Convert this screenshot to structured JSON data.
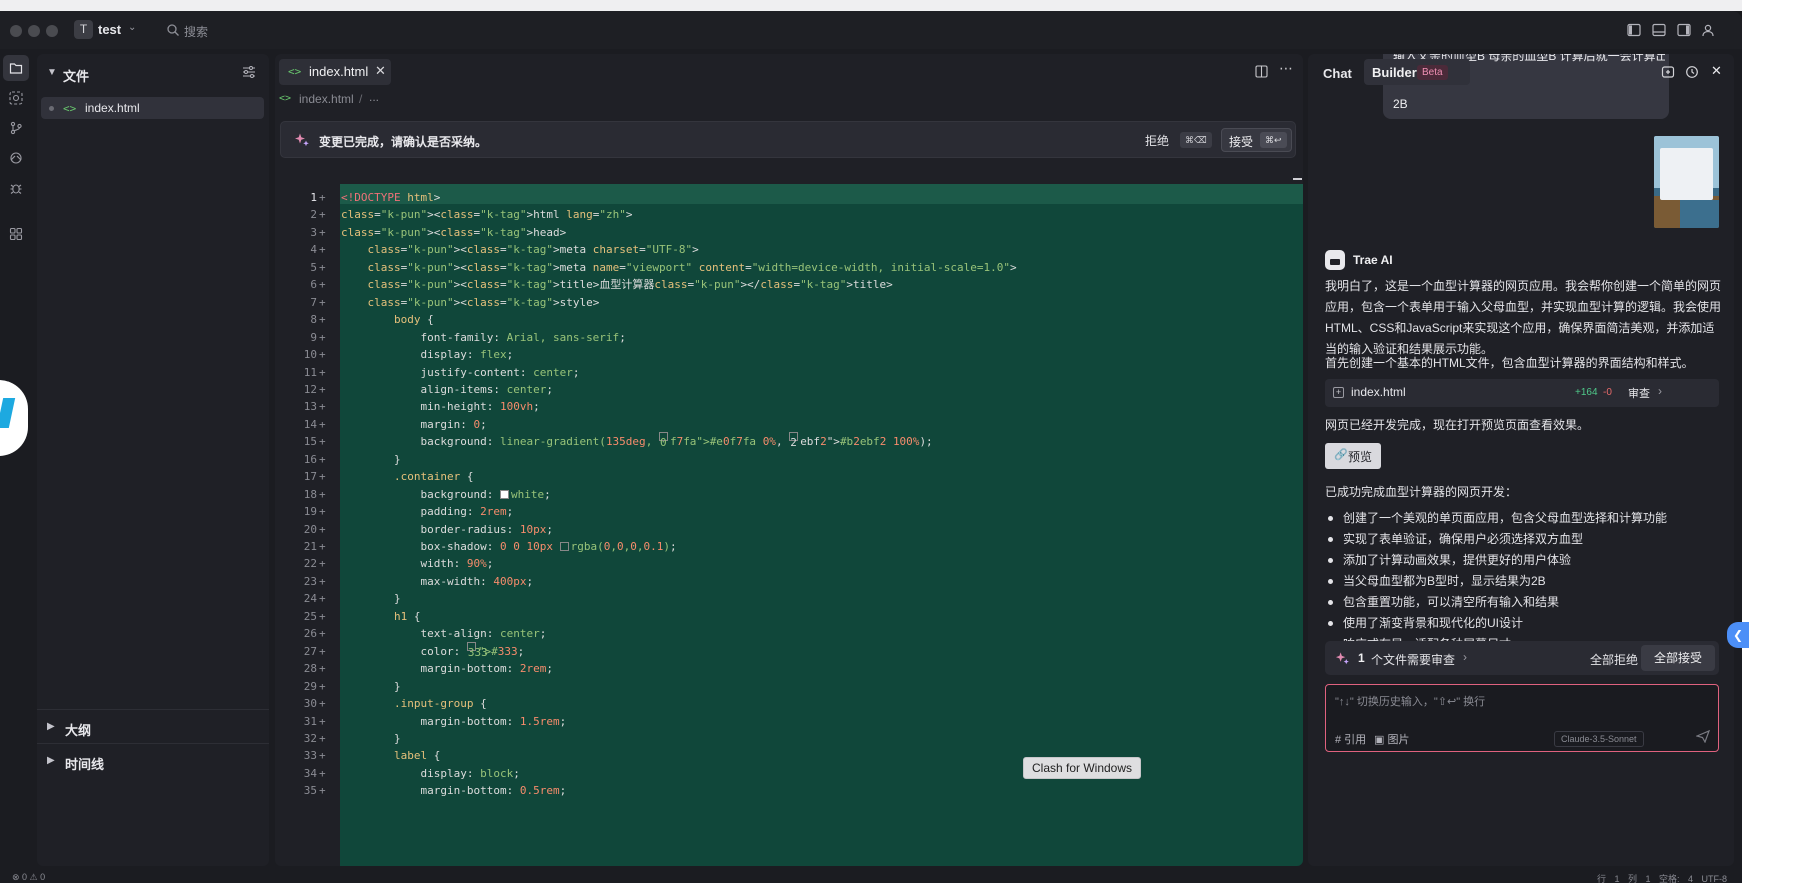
{
  "titlebar": {
    "project_initial": "T",
    "project_name": "test",
    "search_placeholder": "搜索"
  },
  "explorer": {
    "title": "文件",
    "file": "index.html",
    "sections": [
      "大纲",
      "时间线"
    ]
  },
  "editor": {
    "tab_label": "index.html",
    "breadcrumb_file": "index.html",
    "breadcrumb_more": "...",
    "notice": "变更已完成，请确认是否采纳。",
    "reject_label": "拒绝",
    "reject_shortcut": "⌘⌫",
    "accept_label": "接受",
    "accept_shortcut": "⌘↩",
    "code_lines": [
      "<!DOCTYPE html>",
      "<html lang=\"zh\">",
      "<head>",
      "    <meta charset=\"UTF-8\">",
      "    <meta name=\"viewport\" content=\"width=device-width, initial-scale=1.0\">",
      "    <title>血型计算器</title>",
      "    <style>",
      "        body {",
      "            font-family: Arial, sans-serif;",
      "            display: flex;",
      "            justify-content: center;",
      "            align-items: center;",
      "            min-height: 100vh;",
      "            margin: 0;",
      "            background: linear-gradient(135deg, #e0f7fa 0%, #b2ebf2 100%);",
      "        }",
      "        .container {",
      "            background: white;",
      "            padding: 2rem;",
      "            border-radius: 10px;",
      "            box-shadow: 0 0 10px rgba(0,0,0,0.1);",
      "            width: 90%;",
      "            max-width: 400px;",
      "        }",
      "        h1 {",
      "            text-align: center;",
      "            color: #333;",
      "            margin-bottom: 2rem;",
      "        }",
      "        .input-group {",
      "            margin-bottom: 1.5rem;",
      "        }",
      "        label {",
      "            display: block;",
      "            margin-bottom: 0.5rem;"
    ]
  },
  "chat": {
    "tab_chat": "Chat",
    "tab_builder": "Builder",
    "beta_badge": "Beta",
    "user_message_partial": "输入父亲的血型B 母亲的血型B 计算后就一会计算出 血型为",
    "user_message_tail": "2B",
    "ai_name": "Trae AI",
    "para1": "我明白了，这是一个血型计算器的网页应用。我会帮你创建一个简单的网页应用，包含一个表单用于输入父母血型，并实现血型计算的逻辑。我会使用HTML、CSS和JavaScript来实现这个应用，确保界面简洁美观，并添加适当的输入验证和结果展示功能。",
    "para2": "首先创建一个基本的HTML文件，包含血型计算器的界面结构和样式。",
    "file_card": {
      "name": "index.html",
      "added": "+164",
      "removed": "-0",
      "review": "审查"
    },
    "para3": "网页已经开发完成，现在打开预览页面查看效果。",
    "preview_label": "预览",
    "summary_title": "已成功完成血型计算器的网页开发：",
    "bullets": [
      "创建了一个美观的单页面应用，包含父母血型选择和计算功能",
      "实现了表单验证，确保用户必须选择双方血型",
      "添加了计算动画效果，提供更好的用户体验",
      "当父母血型都为B型时，显示结果为2B",
      "包含重置功能，可以清空所有输入和结果",
      "使用了渐变背景和现代化的UI设计",
      "响应式布局，适配各种屏幕尺寸"
    ],
    "review_bar": {
      "count": "1",
      "text": "个文件需要审查",
      "reject_all": "全部拒绝",
      "accept_all": "全部接受"
    },
    "input_placeholder": "\"↑↓\" 切换历史输入，\"⇧↩\" 换行",
    "ref_label": "# 引用",
    "image_label": "图片",
    "model": "Claude-3.5-Sonnet"
  },
  "statusbar": {
    "left": "⊗ 0 ⚠ 0",
    "right": "行 1  列 1  空格: 4  UTF-8  LF  HTML"
  },
  "tooltip": "Clash for Windows"
}
